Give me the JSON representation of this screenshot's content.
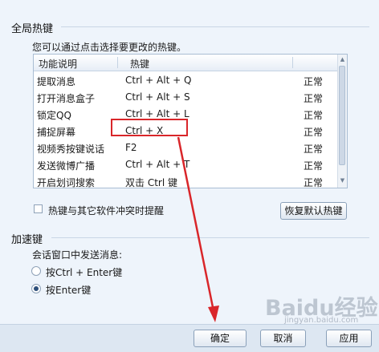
{
  "global_hotkeys": {
    "section_title": "全局热键",
    "hint": "您可以通过点击选择要更改的热键。",
    "columns": [
      "功能说明",
      "热键"
    ],
    "rows": [
      {
        "function": "提取消息",
        "hotkey": "Ctrl + Alt + Q",
        "status": "正常"
      },
      {
        "function": "打开消息盒子",
        "hotkey": "Ctrl + Alt + S",
        "status": "正常"
      },
      {
        "function": "锁定QQ",
        "hotkey": "Ctrl + Alt + L",
        "status": "正常"
      },
      {
        "function": "捕捉屏幕",
        "hotkey": "Ctrl + X",
        "status": "正常"
      },
      {
        "function": "视频秀按键说话",
        "hotkey": "F2",
        "status": "正常"
      },
      {
        "function": "发送微博广播",
        "hotkey": "Ctrl + Alt + T",
        "status": "正常"
      },
      {
        "function": "开启划词搜索",
        "hotkey": "双击 Ctrl 键",
        "status": "正常"
      }
    ],
    "conflict_label": "热键与其它软件冲突时提醒",
    "restore_label": "恢复默认热键"
  },
  "accelerator": {
    "section_title": "加速键",
    "send_label": "会话窗口中发送消息:",
    "options": [
      "按Ctrl + Enter键",
      "按Enter键"
    ],
    "selected_index": 1
  },
  "footer": {
    "ok": "确定",
    "cancel": "取消",
    "apply": "应用"
  },
  "watermark": {
    "logo": "Baidu经验",
    "domain": "jingyan.baidu.com"
  },
  "colors": {
    "highlight": "#d9262a",
    "background": "#eef4fb"
  }
}
